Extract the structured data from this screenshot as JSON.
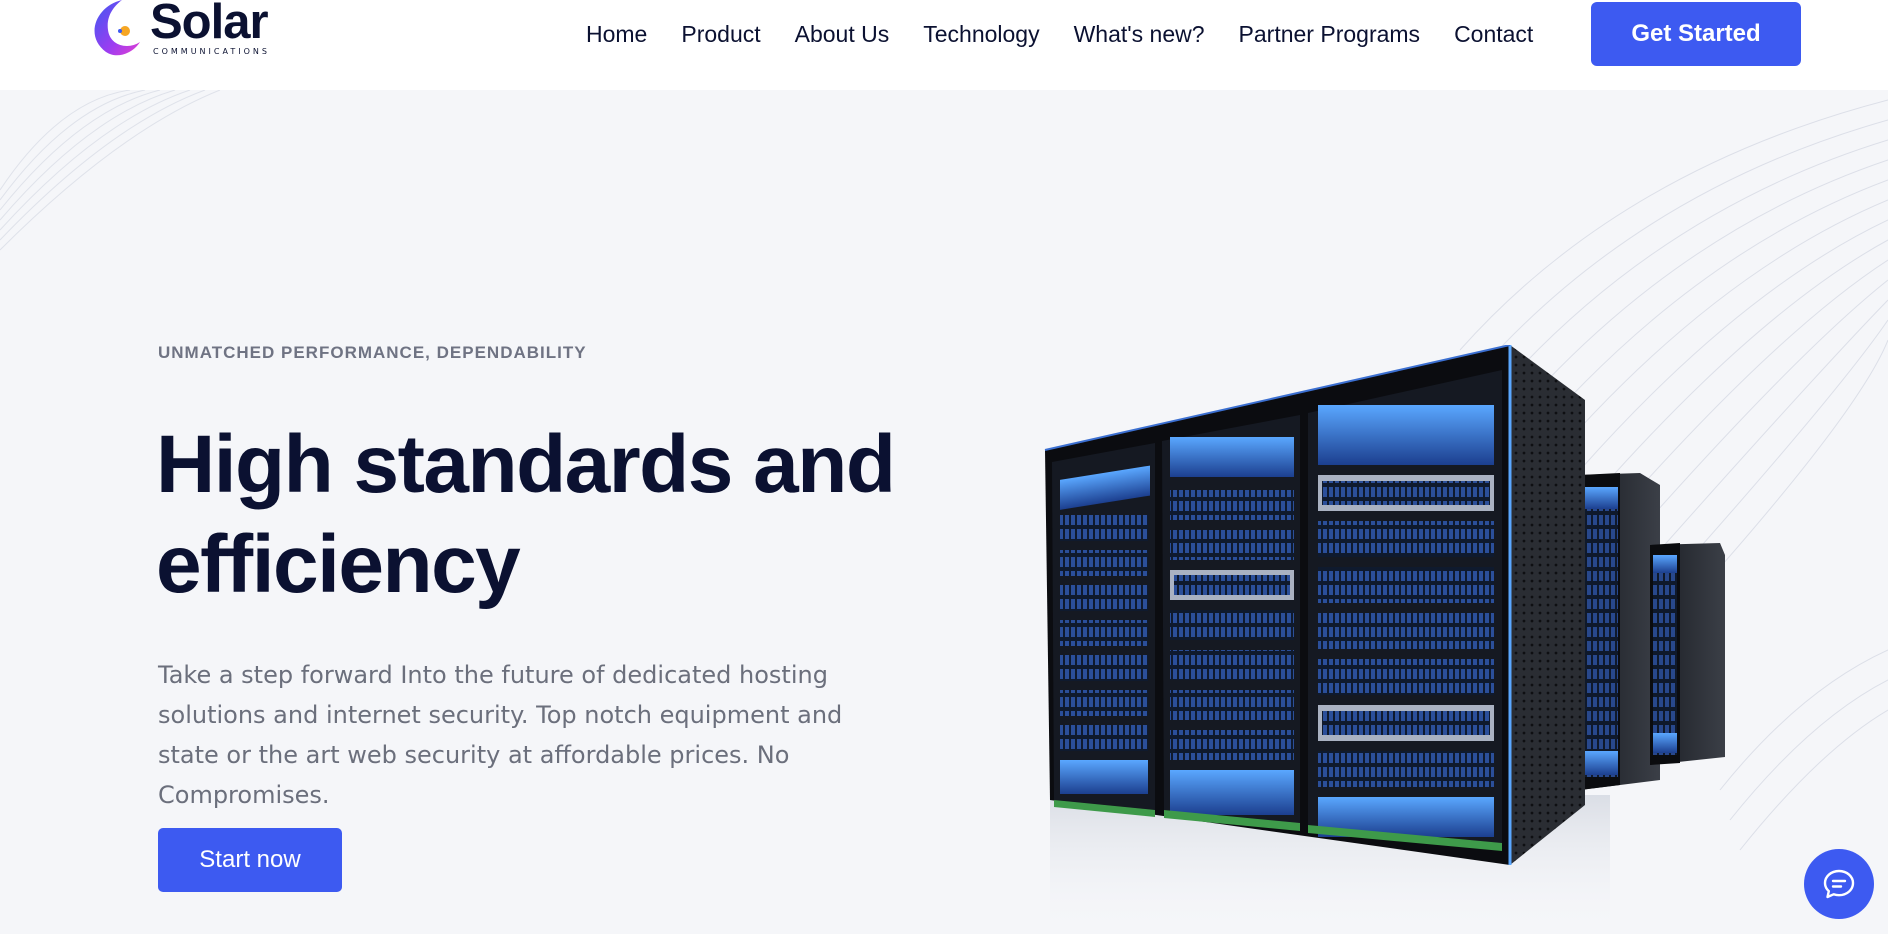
{
  "brand": {
    "name": "Solar",
    "tagline": "COMMUNICATIONS"
  },
  "nav": {
    "items": [
      {
        "label": "Home"
      },
      {
        "label": "Product"
      },
      {
        "label": "About Us"
      },
      {
        "label": "Technology"
      },
      {
        "label": "What's new?"
      },
      {
        "label": "Partner Programs"
      },
      {
        "label": "Contact"
      }
    ],
    "cta_label": "Get Started"
  },
  "hero": {
    "eyebrow": "UNMATCHED PERFORMANCE, DEPENDABILITY",
    "headline_line1": "High standards and",
    "headline_line2": "efficiency",
    "body": "Take a step forward Into the future of dedicated hosting solutions and internet security. Top notch equipment and state or the art web security at affordable prices. No Compromises.",
    "cta_label": "Start now"
  },
  "icons": {
    "logo": "solar-logo-icon",
    "chat": "chat-bubble-icon"
  },
  "colors": {
    "accent": "#3d5af1",
    "heading": "#0b1131",
    "body_text": "#6b6f7c",
    "eyebrow": "#6f7383",
    "page_bg": "#f5f6f9"
  }
}
